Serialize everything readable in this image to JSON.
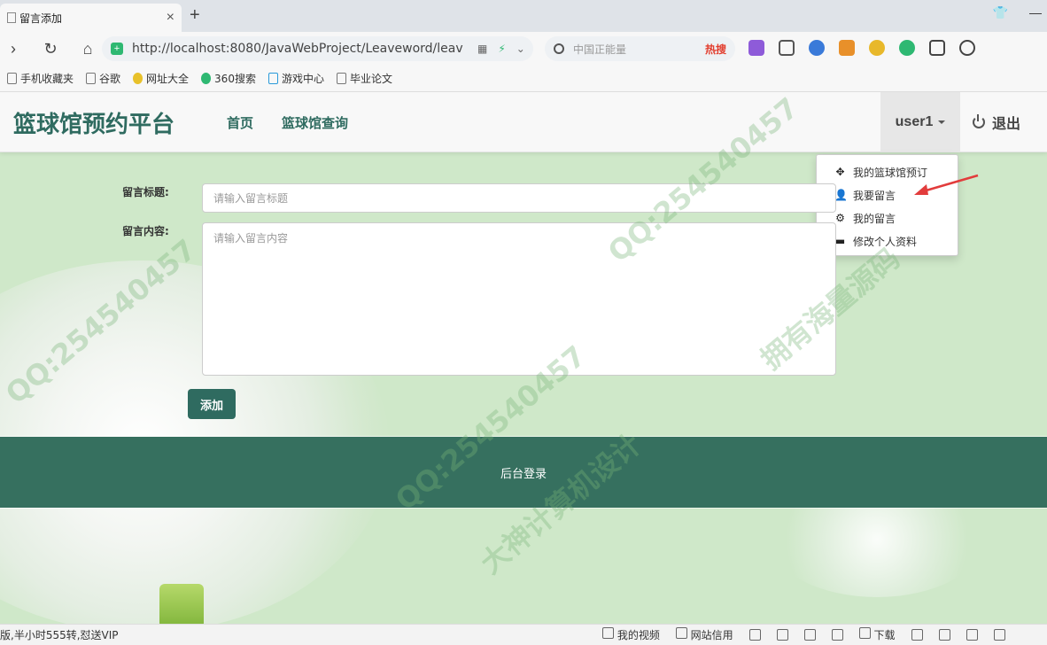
{
  "browser": {
    "tab_title": "留言添加",
    "tab_close": "×",
    "new_tab": "+",
    "url": "http://localhost:8080/JavaWebProject/Leaveword/leav",
    "search_placeholder": "中国正能量",
    "search_hot": "热搜",
    "bookmarks": [
      {
        "label": "手机收藏夹",
        "icon": "mobile-icon"
      },
      {
        "label": "谷歌",
        "icon": "page-icon"
      },
      {
        "label": "网址大全",
        "icon": "globe-icon"
      },
      {
        "label": "360搜索",
        "icon": "search-icon"
      },
      {
        "label": "游戏中心",
        "icon": "gamepad-icon"
      },
      {
        "label": "毕业论文",
        "icon": "page-icon"
      }
    ]
  },
  "navbar": {
    "brand": "篮球馆预约平台",
    "links": [
      "首页",
      "篮球馆查询"
    ],
    "user": "user1",
    "logout": "退出"
  },
  "dropdown": {
    "items": [
      {
        "label": "我的篮球馆预订",
        "icon": "move-icon"
      },
      {
        "label": "我要留言",
        "icon": "user-icon"
      },
      {
        "label": "我的留言",
        "icon": "gear-icon"
      },
      {
        "label": "修改个人资料",
        "icon": "card-icon"
      }
    ]
  },
  "form": {
    "title_label": "留言标题:",
    "title_placeholder": "请输入留言标题",
    "content_label": "留言内容:",
    "content_placeholder": "请输入留言内容",
    "submit": "添加"
  },
  "footer": {
    "admin_login": "后台登录"
  },
  "statusbar": {
    "left_text": "版,半小时555转,怼送VIP",
    "items": [
      "我的视频",
      "网站信用",
      "下载"
    ]
  },
  "watermarks": [
    "拥有海量源码",
    "QQ:254540457",
    "大神计算机设计"
  ],
  "colors": {
    "brand": "#2f6b60",
    "footer": "#36705f",
    "page_bg": "#cfe8c9",
    "arrow": "#e23c3c"
  }
}
